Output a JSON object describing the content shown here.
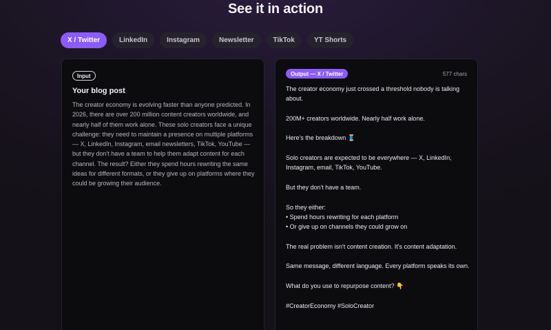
{
  "section": {
    "heading": "See it in action"
  },
  "tabs": [
    {
      "label": "X / Twitter",
      "active": true
    },
    {
      "label": "LinkedIn",
      "active": false
    },
    {
      "label": "Instagram",
      "active": false
    },
    {
      "label": "Newsletter",
      "active": false
    },
    {
      "label": "TikTok",
      "active": false
    },
    {
      "label": "YT Shorts",
      "active": false
    }
  ],
  "input_card": {
    "badge": "Input",
    "title": "Your blog post",
    "body": "The creator economy is evolving faster than anyone predicted. In 2026, there are over 200 million content creators worldwide, and nearly half of them work alone. These solo creators face a unique challenge: they need to maintain a presence on multiple platforms — X, LinkedIn, Instagram, email newsletters, TikTok, YouTube — but they don't have a team to help them adapt content for each channel. The result? Either they spend hours rewriting the same ideas for different formats, or they give up on platforms where they could be growing their audience."
  },
  "output_card": {
    "badge": "Output — X / Twitter",
    "char_count": "577 chars",
    "paragraphs": [
      {
        "lines": [
          "The creator economy just crossed a threshold nobody is talking about."
        ]
      },
      {
        "lines": [
          "200M+ creators worldwide. Nearly half work alone."
        ]
      },
      {
        "lines": [
          "Here's the breakdown"
        ],
        "emoji": "🧵"
      },
      {
        "lines": [
          "Solo creators are expected to be everywhere — X, LinkedIn, Instagram, email, TikTok, YouTube."
        ]
      },
      {
        "lines": [
          "But they don't have a team."
        ]
      },
      {
        "lines": [
          "So they either:",
          "• Spend hours rewriting for each platform",
          "• Or give up on channels they could grow on"
        ]
      },
      {
        "lines": [
          "The real problem isn't content creation. It's content adaptation."
        ]
      },
      {
        "lines": [
          "Same message, different language. Every platform speaks its own."
        ]
      },
      {
        "lines": [
          "What do you use to repurpose content?"
        ],
        "emoji": "👇"
      },
      {
        "lines": [
          "#CreatorEconomy #SoloCreator"
        ]
      }
    ]
  },
  "colors": {
    "accent": "#8b5cf6",
    "background": "#16111d",
    "card": "#0c0c0f"
  }
}
